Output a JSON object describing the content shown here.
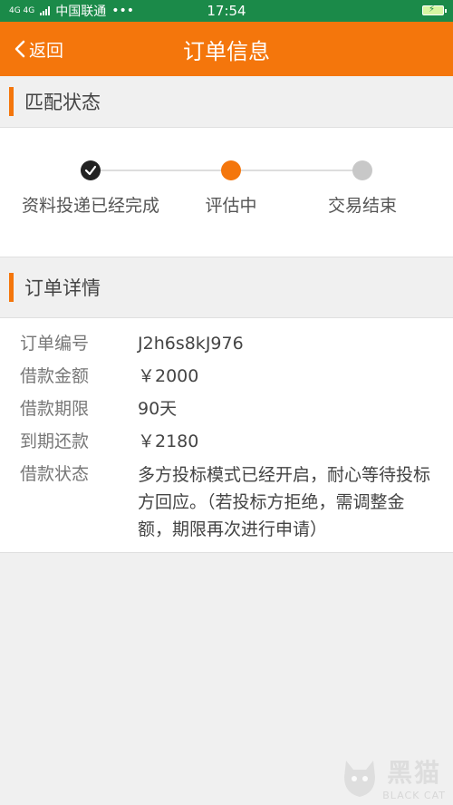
{
  "status_bar": {
    "network": "4G 4G",
    "carrier": "中国联通",
    "dots": "•••",
    "time": "17:54"
  },
  "nav": {
    "back_label": "返回",
    "title": "订单信息"
  },
  "match_section": {
    "title": "匹配状态",
    "steps": [
      {
        "label": "资料投递已经完成",
        "state": "done"
      },
      {
        "label": "评估中",
        "state": "current"
      },
      {
        "label": "交易结束",
        "state": "pending"
      }
    ]
  },
  "detail_section": {
    "title": "订单详情",
    "rows": [
      {
        "key": "订单编号",
        "value": "J2h6s8kJ976"
      },
      {
        "key": "借款金额",
        "value": "￥2000"
      },
      {
        "key": "借款期限",
        "value": "90天"
      },
      {
        "key": "到期还款",
        "value": "￥2180"
      },
      {
        "key": "借款状态",
        "value": "多方投标模式已经开启，耐心等待投标方回应。（若投标方拒绝，需调整金额，期限再次进行申请）"
      }
    ]
  },
  "watermark": {
    "cn": "黑猫",
    "en": "BLACK CAT"
  },
  "colors": {
    "accent": "#f4760c",
    "status_bar": "#1b8a49",
    "done": "#222222",
    "pending": "#c8c8c8"
  }
}
